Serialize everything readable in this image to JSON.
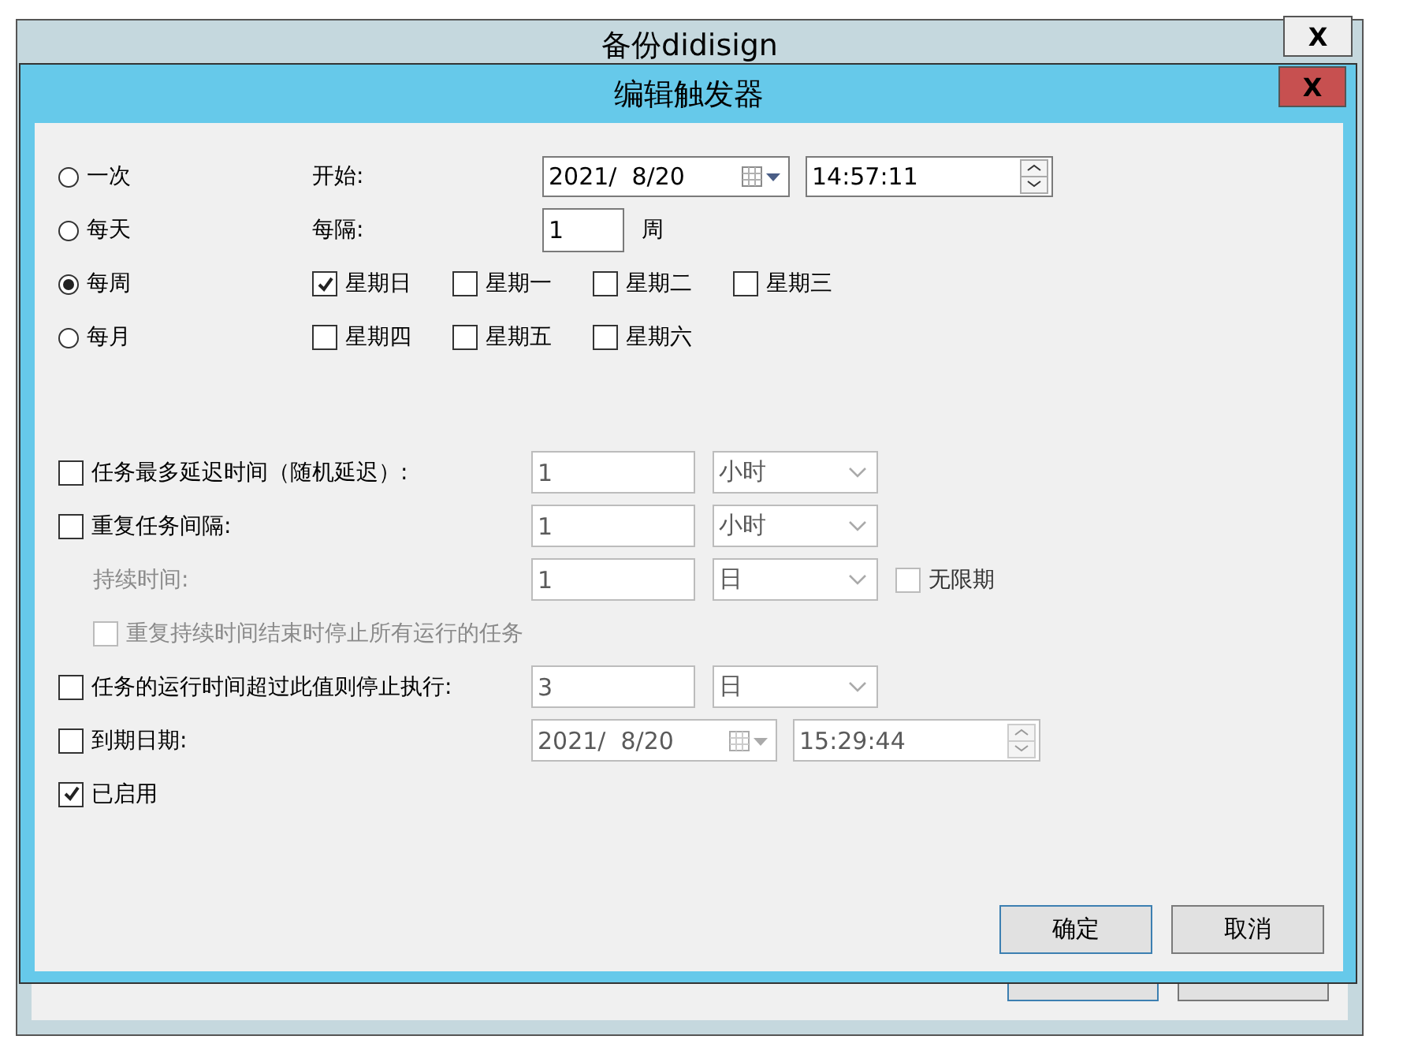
{
  "back_window": {
    "title": "备份didisign",
    "close": "X"
  },
  "dialog": {
    "title": "编辑触发器",
    "close": "X"
  },
  "schedule": [
    {
      "label": "一次",
      "selected": false
    },
    {
      "label": "每天",
      "selected": false
    },
    {
      "label": "每周",
      "selected": true
    },
    {
      "label": "每月",
      "selected": false
    }
  ],
  "start": {
    "label": "开始:",
    "date": "2021/  8/20",
    "time": "14:57:11"
  },
  "interval": {
    "label": "每隔:",
    "value": "1",
    "unit": "周"
  },
  "weekdays": [
    {
      "label": "星期日",
      "checked": true
    },
    {
      "label": "星期一",
      "checked": false
    },
    {
      "label": "星期二",
      "checked": false
    },
    {
      "label": "星期三",
      "checked": false
    },
    {
      "label": "星期四",
      "checked": false
    },
    {
      "label": "星期五",
      "checked": false
    },
    {
      "label": "星期六",
      "checked": false
    }
  ],
  "advanced": [
    {
      "kind": "option",
      "label": "任务最多延迟时间（随机延迟）:",
      "checked": false,
      "value": "1",
      "unit": "小时"
    },
    {
      "kind": "option",
      "label": "重复任务间隔:",
      "checked": false,
      "value": "1",
      "unit": "小时"
    },
    {
      "kind": "duration",
      "label": "持续时间:",
      "value": "1",
      "unit": "日",
      "extra": {
        "label": "无限期",
        "checked": false
      }
    },
    {
      "kind": "substop",
      "label": "重复持续时间结束时停止所有运行的任务",
      "checked": false
    },
    {
      "kind": "option",
      "label": "任务的运行时间超过此值则停止执行:",
      "checked": false,
      "value": "3",
      "unit": "日"
    },
    {
      "kind": "expiry",
      "label": "到期日期:",
      "checked": false,
      "date": "2021/  8/20",
      "time": "15:29:44"
    },
    {
      "kind": "toggle",
      "label": "已启用",
      "checked": true
    }
  ],
  "buttons": [
    "确定",
    "取消"
  ]
}
